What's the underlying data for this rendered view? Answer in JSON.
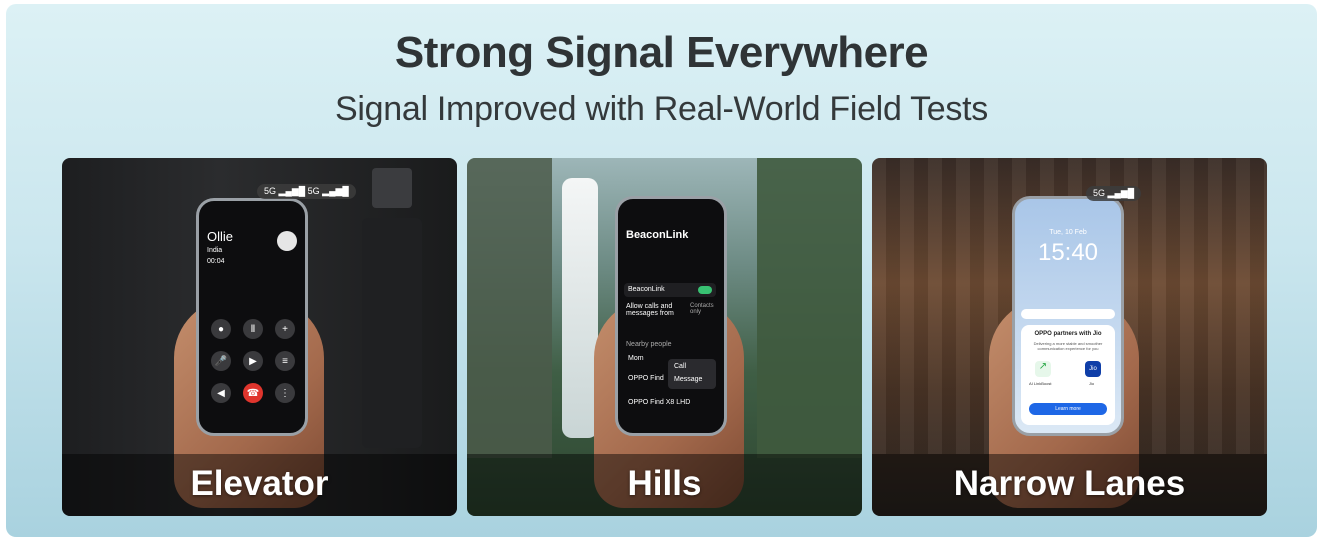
{
  "header": {
    "title": "Strong Signal Everywhere",
    "subtitle": "Signal Improved with Real-World Field Tests"
  },
  "cards": [
    {
      "label": "Elevator",
      "signal": "5G",
      "screen": {
        "caller": "Ollie",
        "location": "India",
        "duration": "00:04",
        "buttons": [
          "Record",
          "Hold",
          "Add call",
          "Mute",
          "Video call",
          "Notes",
          "Speaker",
          "End",
          "Dial pad"
        ]
      }
    },
    {
      "label": "Hills",
      "screen": {
        "app_title": "BeaconLink",
        "toggle_label": "BeaconLink",
        "setting_label": "Allow calls and messages from",
        "setting_value": "Contacts only",
        "section": "Nearby people",
        "contacts": [
          "Mom",
          "OPPO Find",
          "OPPO Find X8 LHD"
        ],
        "actions": [
          "Call",
          "Message"
        ]
      }
    },
    {
      "label": "Narrow Lanes",
      "signal": "5G",
      "screen": {
        "date": "Tue, 10 Feb",
        "time": "15:40",
        "popup_title": "OPPO partners with Jio",
        "popup_text": "Delivering a more stable and smoother communication experience for you",
        "left_app": "AI LinkBoost",
        "right_app": "Jio",
        "button": "Learn more"
      }
    }
  ]
}
